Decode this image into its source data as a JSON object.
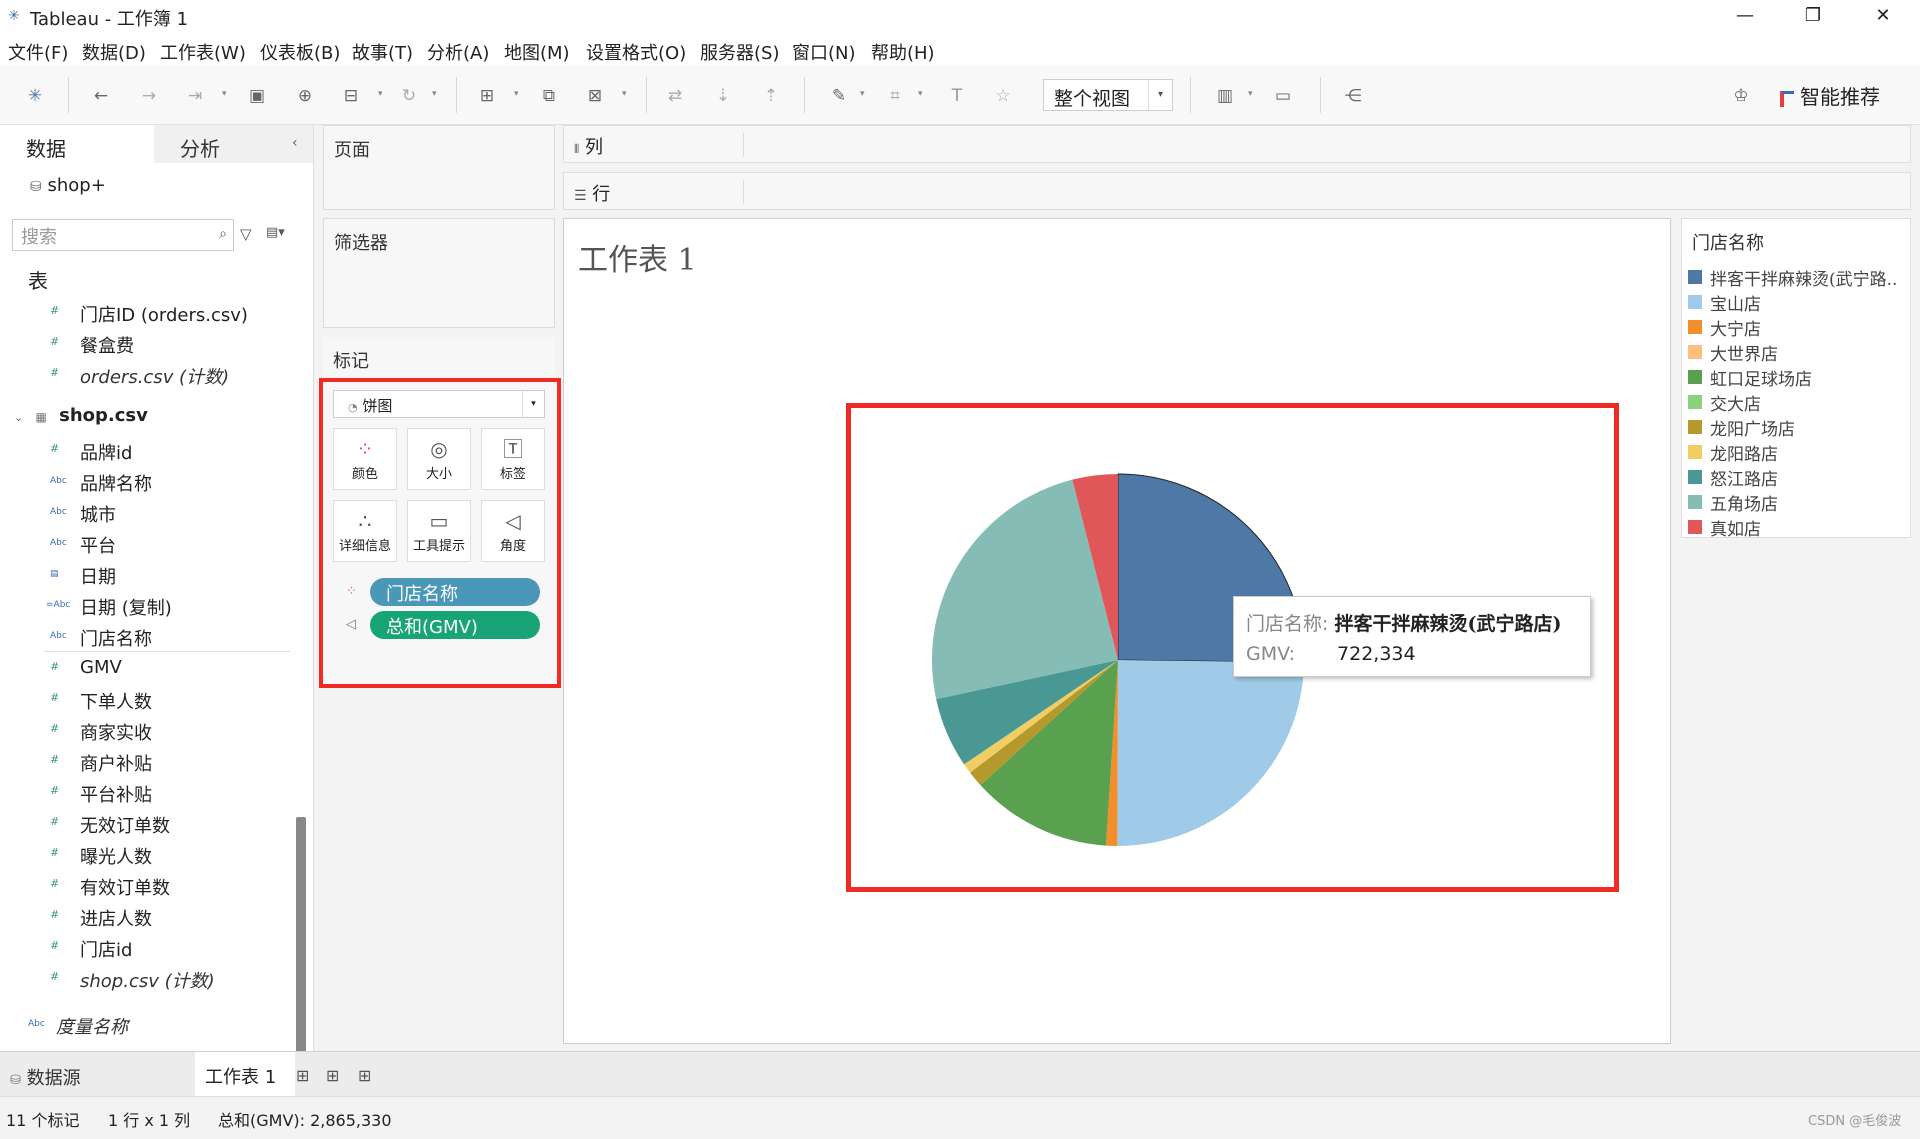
{
  "window": {
    "title": "Tableau - 工作簿 1",
    "minimize": "—",
    "restore": "❐",
    "close": "✕"
  },
  "menu": [
    "文件(F)",
    "数据(D)",
    "工作表(W)",
    "仪表板(B)",
    "故事(T)",
    "分析(A)",
    "地图(M)",
    "设置格式(O)",
    "服务器(S)",
    "窗口(N)",
    "帮助(H)"
  ],
  "toolbar": {
    "view_mode": "整个视图",
    "smart_label": "智能推荐"
  },
  "data_pane": {
    "tab_data": "数据",
    "tab_analysis": "分析",
    "datasource": "shop+",
    "search_placeholder": "搜索",
    "section_table": "表",
    "orders_fields": [
      {
        "type": "#",
        "name": "门店ID (orders.csv)"
      },
      {
        "type": "#",
        "name": "餐盒费"
      },
      {
        "type": "#",
        "name": "orders.csv (计数)"
      }
    ],
    "shop_table": "shop.csv",
    "shop_fields": [
      {
        "type": "#",
        "name": "品牌id"
      },
      {
        "type": "Abc",
        "name": "品牌名称"
      },
      {
        "type": "Abc",
        "name": "城市"
      },
      {
        "type": "Abc",
        "name": "平台"
      },
      {
        "type": "▤",
        "name": "日期"
      },
      {
        "type": "=Abc",
        "name": "日期 (复制)"
      },
      {
        "type": "Abc",
        "name": "门店名称"
      },
      {
        "type": "#",
        "name": "GMV"
      },
      {
        "type": "#",
        "name": "下单人数"
      },
      {
        "type": "#",
        "name": "商家实收"
      },
      {
        "type": "#",
        "name": "商户补贴"
      },
      {
        "type": "#",
        "name": "平台补贴"
      },
      {
        "type": "#",
        "name": "无效订单数"
      },
      {
        "type": "#",
        "name": "曝光人数"
      },
      {
        "type": "#",
        "name": "有效订单数"
      },
      {
        "type": "#",
        "name": "进店人数"
      },
      {
        "type": "#",
        "name": "门店id"
      },
      {
        "type": "#",
        "name": "shop.csv (计数)"
      }
    ],
    "measure_names": "度量名称"
  },
  "shelves": {
    "pages": "页面",
    "filters": "筛选器",
    "marks": "标记",
    "columns": "列",
    "rows": "行"
  },
  "marks": {
    "type": "饼图",
    "buttons": [
      "颜色",
      "大小",
      "标签",
      "详细信息",
      "工具提示",
      "角度"
    ],
    "pill_color": "门店名称",
    "pill_angle": "总和(GMV)"
  },
  "sheet": {
    "title": "工作表 1"
  },
  "tooltip": {
    "label1": "门店名称:",
    "value1": "拌客干拌麻辣烫(武宁路店)",
    "label2": "GMV:",
    "value2": "722,334"
  },
  "legend": {
    "title": "门店名称",
    "items": [
      {
        "name": "拌客干拌麻辣烫(武宁路..",
        "color": "#4e79a7"
      },
      {
        "name": "宝山店",
        "color": "#a0cbe8"
      },
      {
        "name": "大宁店",
        "color": "#f28e2b"
      },
      {
        "name": "大世界店",
        "color": "#ffbe7d"
      },
      {
        "name": "虹口足球场店",
        "color": "#59a14f"
      },
      {
        "name": "交大店",
        "color": "#8cd17d"
      },
      {
        "name": "龙阳广场店",
        "color": "#b6992d"
      },
      {
        "name": "龙阳路店",
        "color": "#f1ce63"
      },
      {
        "name": "怒江路店",
        "color": "#499894"
      },
      {
        "name": "五角场店",
        "color": "#86bcb6"
      },
      {
        "name": "真如店",
        "color": "#e15759"
      }
    ]
  },
  "chart_data": {
    "type": "pie",
    "categories": [
      "拌客干拌麻辣烫(武宁路店)",
      "宝山店",
      "大宁店",
      "大世界店",
      "虹口足球场店",
      "交大店",
      "龙阳广场店",
      "龙阳路店",
      "怒江路店",
      "五角场店",
      "真如店"
    ],
    "values": [
      722334,
      712000,
      28000,
      0,
      350000,
      0,
      40000,
      25000,
      175000,
      700000,
      113000
    ],
    "colors": [
      "#4e79a7",
      "#a0cbe8",
      "#f28e2b",
      "#ffbe7d",
      "#59a14f",
      "#8cd17d",
      "#b6992d",
      "#f1ce63",
      "#499894",
      "#86bcb6",
      "#e15759"
    ],
    "total": 2865330
  },
  "tabs": {
    "datasource": "数据源",
    "sheet": "工作表 1"
  },
  "status": {
    "marks": "11 个标记",
    "dims": "1 行 x 1 列",
    "sum": "总和(GMV): 2,865,330"
  },
  "watermark": "CSDN @毛俊波"
}
